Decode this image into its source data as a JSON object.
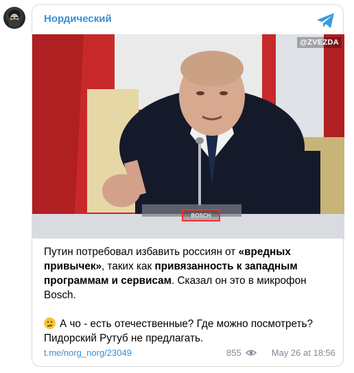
{
  "channel": {
    "name": "Нордический"
  },
  "photo": {
    "watermark": "@ZVEZDA",
    "mic_label": "BOSCH"
  },
  "post": {
    "p1_a": "Путин потребовал избавить россиян от ",
    "p1_b": "«вредных привычек»",
    "p1_c": ", таких как ",
    "p1_d": "привязанность к западным программам и сервисам",
    "p1_e": ". Сказал он это в микрофон Bosch.",
    "p2": "А чо - есть отечественные? Где можно посмотреть? Пидорский Рутуб не предлагать."
  },
  "footer": {
    "link": "t.me/norg_norg/23049",
    "views": "855",
    "date": "May 26 at 18:56"
  },
  "colors": {
    "accent": "#3a8fd0",
    "muted": "#7f8a96"
  },
  "icons": [
    "telegram-icon",
    "eye-icon",
    "emoji-icon"
  ]
}
